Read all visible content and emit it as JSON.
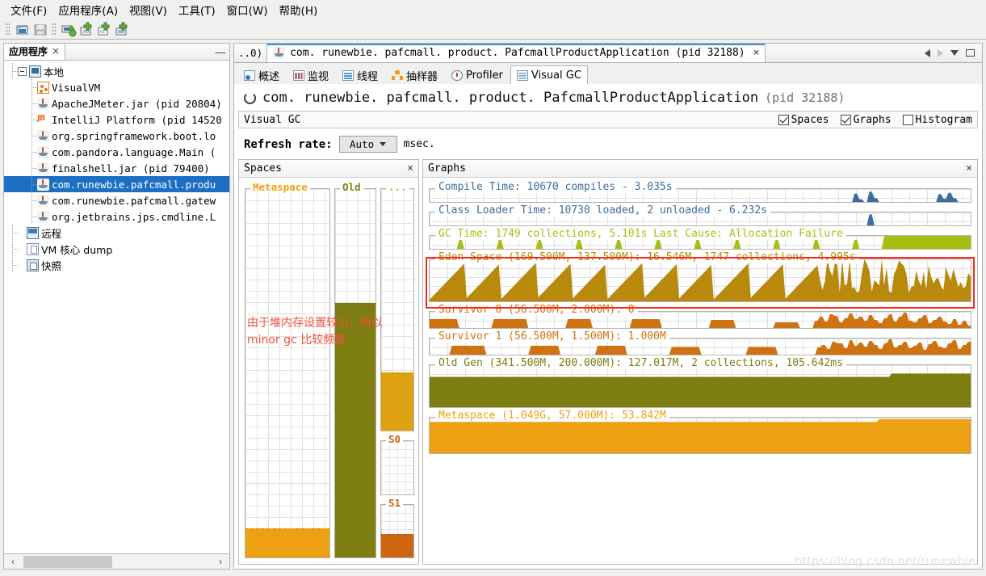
{
  "window": {
    "menu": [
      {
        "label": "文件(F)",
        "name": "menu-file"
      },
      {
        "label": "应用程序(A)",
        "name": "menu-applications"
      },
      {
        "label": "视图(V)",
        "name": "menu-view"
      },
      {
        "label": "工具(T)",
        "name": "menu-tools"
      },
      {
        "label": "窗口(W)",
        "name": "menu-window"
      },
      {
        "label": "帮助(H)",
        "name": "menu-help"
      }
    ],
    "toolbar_buttons": [
      {
        "name": "load-snapshot-button",
        "icon": "open-folder-icon"
      },
      {
        "name": "save-snapshot-button",
        "icon": "save-disk-icon"
      },
      {
        "name": "add-remote-host-button",
        "icon": "add-host-icon"
      },
      {
        "name": "add-jmx-connection-button",
        "icon": "add-jmx-icon"
      },
      {
        "name": "add-core-dump-button",
        "icon": "add-coredump-icon"
      },
      {
        "name": "add-application-button",
        "icon": "add-application-icon"
      }
    ],
    "watermark": "https://blog.csdn.net/runewbie"
  },
  "sidebar": {
    "tab_label": "应用程序",
    "tab_close": "×",
    "minimize": "—",
    "tree": [
      {
        "label": "本地",
        "icon": "monitor-icon",
        "level": 0,
        "selected": false,
        "expander": true
      },
      {
        "label": "VisualVM",
        "icon": "visualvm-icon",
        "level": 1,
        "selected": false
      },
      {
        "label": "ApacheJMeter.jar (pid 20804)",
        "icon": "java-icon",
        "level": 1,
        "selected": false
      },
      {
        "label": "IntelliJ Platform (pid 14520",
        "icon": "intellij-icon",
        "level": 1,
        "selected": false
      },
      {
        "label": "org.springframework.boot.lo",
        "icon": "java-icon",
        "level": 1,
        "selected": false
      },
      {
        "label": "com.pandora.language.Main (",
        "icon": "java-icon",
        "level": 1,
        "selected": false
      },
      {
        "label": "finalshell.jar (pid 79400)",
        "icon": "java-icon",
        "level": 1,
        "selected": false
      },
      {
        "label": "com.runewbie.pafcmall.produ",
        "icon": "java-icon",
        "level": 1,
        "selected": true
      },
      {
        "label": "com.runewbie.pafcmall.gatew",
        "icon": "java-icon",
        "level": 1,
        "selected": false
      },
      {
        "label": "org.jetbrains.jps.cmdline.L",
        "icon": "java-icon",
        "level": 1,
        "selected": false
      },
      {
        "label": "远程",
        "icon": "remote-icon",
        "level": 0,
        "selected": false
      },
      {
        "label": "VM 核心 dump",
        "icon": "coredump-icon",
        "level": 0,
        "selected": false
      },
      {
        "label": "快照",
        "icon": "snapshot-icon",
        "level": 0,
        "selected": false
      }
    ],
    "scroll_left": "‹",
    "scroll_right": "›"
  },
  "app_tabs": {
    "clipped_label": "..0)",
    "active_label": "com. runewbie. pafcmall. product. PafcmallProductApplication  (pid 32188)",
    "close": "×"
  },
  "subtabs": [
    {
      "label": "概述",
      "icon": "overview-icon",
      "active": false
    },
    {
      "label": "监视",
      "icon": "monitor-chart-icon",
      "active": false
    },
    {
      "label": "线程",
      "icon": "threads-icon",
      "active": false
    },
    {
      "label": "抽样器",
      "icon": "sampler-icon",
      "active": false
    },
    {
      "label": "Profiler",
      "icon": "profiler-icon",
      "active": false
    },
    {
      "label": "Visual GC",
      "icon": "visualgc-icon",
      "active": true
    }
  ],
  "header": {
    "title": "com. runewbie. pafcmall. product. PafcmallProductApplication",
    "pid": "(pid 32188)"
  },
  "vgc_bar": {
    "title": "Visual GC",
    "checkboxes": [
      {
        "label": "Spaces",
        "checked": true,
        "name": "spaces-checkbox"
      },
      {
        "label": "Graphs",
        "checked": true,
        "name": "graphs-checkbox"
      },
      {
        "label": "Histogram",
        "checked": false,
        "name": "histogram-checkbox"
      }
    ]
  },
  "refresh": {
    "label": "Refresh rate:",
    "value": "Auto",
    "unit": "msec."
  },
  "spaces_pane": {
    "title": "Spaces",
    "close": "×",
    "columns": [
      {
        "name": "metaspace-column",
        "label": "Metaspace",
        "color": "#eda012",
        "fill_pct": 8
      },
      {
        "name": "old-column",
        "label": "Old",
        "color": "#7d7d12",
        "fill_pct": 69
      },
      {
        "name": "eden-column",
        "label": "...",
        "color": "#dfa213",
        "fill_pct": 24
      },
      {
        "name": "s0-column",
        "label": "S0",
        "color": "#d06b12",
        "fill_pct": 0
      },
      {
        "name": "s1-column",
        "label": "S1",
        "color": "#cc6611",
        "fill_pct": 45
      }
    ],
    "annotation_line1": "由于堆内存设置较小，所以",
    "annotation_line2": "minor gc 比较频繁",
    "annotation_color": "#f4503c"
  },
  "graphs_pane": {
    "title": "Graphs",
    "close": "×",
    "highlight_color": "#f22c1b",
    "highlighted_graph": "eden-space-graph"
  },
  "chart_data": [
    {
      "type": "area",
      "name": "compile-time-graph",
      "title": "Compile Time: 10670 compiles - 3.035s",
      "color": "#3b6e9e",
      "metrics": {
        "compiles": 10670,
        "total_time_s": 3.035
      },
      "ylim": [
        0,
        100
      ],
      "values": [
        0,
        0,
        0,
        0,
        0,
        0,
        0,
        0,
        0,
        0,
        0,
        0,
        0,
        0,
        0,
        0,
        0,
        0,
        0,
        0,
        0,
        0,
        0,
        0,
        0,
        0,
        0,
        0,
        0,
        0,
        0,
        0,
        0,
        0,
        0,
        0,
        0,
        0,
        0,
        0,
        0,
        0,
        0,
        0,
        0,
        0,
        0,
        0,
        0,
        0,
        0,
        0,
        0,
        0,
        0,
        0,
        0,
        0,
        0,
        0,
        0,
        0,
        0,
        0,
        0,
        0,
        0,
        0,
        0,
        0,
        0,
        0,
        0,
        0,
        0,
        0,
        0,
        0,
        0,
        0,
        0,
        0,
        0,
        0,
        0,
        0,
        65,
        20,
        0,
        80,
        30,
        0,
        0,
        0,
        0,
        0,
        0,
        0,
        0,
        0,
        0,
        0,
        0,
        60,
        25,
        70,
        30,
        0,
        0,
        0
      ]
    },
    {
      "type": "area",
      "name": "class-loader-time-graph",
      "title": "Class Loader Time: 10730 loaded, 2 unloaded - 6.232s",
      "color": "#3b6e9e",
      "metrics": {
        "loaded": 10730,
        "unloaded": 2,
        "total_time_s": 6.232
      },
      "ylim": [
        0,
        100
      ],
      "values": [
        0,
        0,
        0,
        0,
        0,
        0,
        0,
        0,
        0,
        0,
        0,
        0,
        0,
        0,
        0,
        0,
        0,
        0,
        0,
        0,
        0,
        0,
        0,
        0,
        0,
        0,
        0,
        0,
        0,
        0,
        0,
        0,
        0,
        0,
        0,
        0,
        0,
        0,
        0,
        0,
        0,
        0,
        0,
        0,
        0,
        0,
        0,
        0,
        0,
        0,
        0,
        0,
        0,
        0,
        0,
        0,
        0,
        0,
        0,
        0,
        0,
        0,
        0,
        0,
        0,
        0,
        0,
        0,
        0,
        0,
        0,
        0,
        0,
        0,
        0,
        0,
        0,
        0,
        0,
        0,
        0,
        0,
        0,
        0,
        0,
        0,
        0,
        0,
        0,
        85,
        0,
        0,
        0,
        0,
        0,
        0,
        0,
        0,
        0,
        0,
        0,
        0,
        0,
        0,
        0,
        0,
        0,
        0,
        0,
        0
      ]
    },
    {
      "type": "area",
      "name": "gc-time-graph",
      "title": "GC Time: 1749 collections, 5.101s  Last Cause: Allocation Failure",
      "color": "#a8bf12",
      "metrics": {
        "collections": 1749,
        "total_time_s": 5.101,
        "last_cause": "Allocation Failure"
      },
      "ylim": [
        0,
        100
      ],
      "spikes_at": [
        6,
        14,
        22,
        30,
        38,
        46,
        54,
        62,
        70,
        78,
        86
      ],
      "saturated_from": 92,
      "values": [
        0,
        0,
        0,
        0,
        0,
        0,
        70,
        0,
        0,
        0,
        0,
        0,
        0,
        0,
        70,
        0,
        0,
        0,
        0,
        0,
        0,
        0,
        70,
        0,
        0,
        0,
        0,
        0,
        0,
        0,
        70,
        0,
        0,
        0,
        0,
        0,
        0,
        0,
        70,
        0,
        0,
        0,
        0,
        0,
        0,
        0,
        70,
        0,
        0,
        0,
        0,
        0,
        0,
        0,
        70,
        0,
        0,
        0,
        0,
        0,
        0,
        0,
        70,
        0,
        0,
        0,
        0,
        0,
        0,
        0,
        70,
        0,
        0,
        0,
        0,
        0,
        0,
        0,
        70,
        0,
        0,
        0,
        0,
        0,
        0,
        0,
        70,
        0,
        0,
        0,
        0,
        0,
        100,
        100,
        100,
        100,
        100,
        100,
        100,
        100,
        100,
        100,
        100,
        100,
        100,
        100,
        100,
        100,
        100,
        100
      ]
    },
    {
      "type": "area",
      "name": "eden-space-graph",
      "title": "Eden Space (169.500M, 137.500M): 16.546M, 1747 collections, 4.995s",
      "color": "#b8890d",
      "metrics": {
        "capacity": "169.500M",
        "max": "137.500M",
        "used": "16.546M",
        "collections": 1747,
        "time_s": 4.995
      },
      "ylim": [
        0,
        100
      ],
      "pattern": "sawtooth",
      "sawtooth_cycles": 11,
      "noise_from_pct": 72
    },
    {
      "type": "area",
      "name": "survivor-0-graph",
      "title": "Survivor 0 (56.500M, 2.000M): 0",
      "color": "#cf7310",
      "metrics": {
        "capacity": "56.500M",
        "max": "2.000M",
        "used": "0"
      },
      "ylim": [
        0,
        100
      ],
      "pattern": "plateaus",
      "values": [
        55,
        55,
        55,
        55,
        55,
        55,
        0,
        0,
        0,
        0,
        0,
        0,
        0,
        55,
        55,
        55,
        55,
        55,
        55,
        55,
        0,
        0,
        0,
        0,
        0,
        0,
        0,
        0,
        55,
        55,
        55,
        55,
        55,
        0,
        0,
        0,
        0,
        0,
        0,
        0,
        0,
        55,
        55,
        55,
        55,
        55,
        55,
        0,
        0,
        0,
        0,
        0,
        0,
        0,
        0,
        0,
        0,
        50,
        50,
        50,
        50,
        50,
        0,
        0,
        0,
        0,
        0,
        0,
        0,
        0,
        35,
        35,
        35,
        35,
        35,
        0,
        0,
        0,
        45,
        70,
        40,
        85,
        75,
        35,
        60,
        90,
        55,
        70,
        45,
        80,
        50,
        30,
        60,
        85,
        40,
        70,
        95,
        45,
        35,
        60,
        80,
        30,
        50,
        70,
        40,
        25,
        55,
        20,
        45,
        15
      ]
    },
    {
      "type": "area",
      "name": "survivor-1-graph",
      "title": "Survivor 1 (56.500M, 1.500M): 1.000M",
      "color": "#cf7310",
      "metrics": {
        "capacity": "56.500M",
        "max": "1.500M",
        "used": "1.000M"
      },
      "ylim": [
        0,
        100
      ],
      "pattern": "plateaus",
      "values": [
        0,
        0,
        0,
        0,
        55,
        55,
        55,
        55,
        55,
        55,
        55,
        0,
        0,
        0,
        0,
        0,
        0,
        0,
        0,
        0,
        55,
        55,
        55,
        55,
        55,
        55,
        0,
        0,
        0,
        0,
        0,
        0,
        0,
        55,
        55,
        55,
        55,
        55,
        55,
        0,
        0,
        0,
        0,
        0,
        0,
        0,
        0,
        0,
        48,
        48,
        48,
        48,
        48,
        48,
        0,
        0,
        0,
        0,
        0,
        0,
        0,
        0,
        0,
        48,
        48,
        48,
        48,
        48,
        48,
        0,
        0,
        0,
        0,
        0,
        0,
        0,
        0,
        45,
        60,
        35,
        80,
        70,
        40,
        90,
        55,
        75,
        50,
        85,
        60,
        35,
        70,
        95,
        45,
        60,
        80,
        40,
        55,
        75,
        30,
        65,
        85,
        50,
        40,
        70,
        90,
        35,
        60,
        80
      ]
    },
    {
      "type": "area",
      "name": "old-gen-graph",
      "title": "Old Gen (341.500M, 200.000M): 127.017M, 2 collections, 105.642ms",
      "color": "#7d7d12",
      "metrics": {
        "capacity": "341.500M",
        "max": "200.000M",
        "used": "127.017M",
        "collections": 2,
        "time_ms": 105.642
      },
      "ylim": [
        0,
        100
      ],
      "base_level": 72,
      "step_up_at_pct": 85,
      "step_level": 80
    },
    {
      "type": "area",
      "name": "metaspace-graph",
      "title": "Metaspace (1.049G, 57.000M): 53.842M",
      "color": "#eda012",
      "metrics": {
        "capacity": "1.049G",
        "committed": "57.000M",
        "used": "53.842M"
      },
      "ylim": [
        0,
        100
      ],
      "base_level": 88,
      "step_up_at_pct": 83,
      "step_level": 96
    }
  ]
}
